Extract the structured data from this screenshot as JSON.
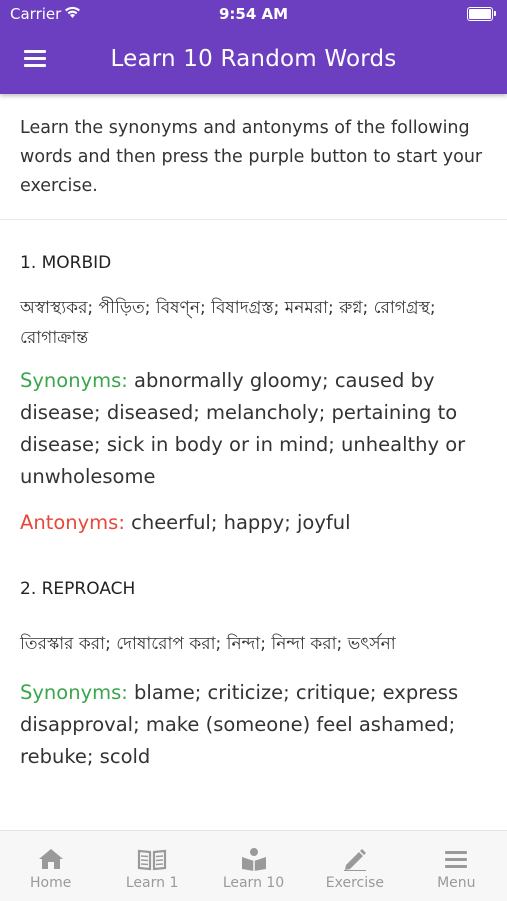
{
  "status_bar": {
    "carrier": "Carrier",
    "time": "9:54 AM"
  },
  "header": {
    "title": "Learn 10 Random Words"
  },
  "intro": "Learn the synonyms and antonyms of the following words and then press the purple button to start your exercise.",
  "labels": {
    "synonyms": "Synonyms:",
    "antonyms": "Antonyms:"
  },
  "words": [
    {
      "title": "1. MORBID",
      "bangla": "অস্বাস্থ্যকর; পীড়িত; বিষণ্ন; বিষাদগ্রস্ত; মনমরা; রুগ্ন; রোগগ্রস্থ; রোগাক্রান্ত",
      "synonyms": "abnormally gloomy; caused by disease; diseased; melancholy; pertaining to disease; sick in body or in mind; unhealthy or unwholesome",
      "antonyms": "cheerful; happy; joyful"
    },
    {
      "title": "2. REPROACH",
      "bangla": "তিরস্কার করা; দোষারোপ করা; নিন্দা; নিন্দা করা; ভৎর্সনা",
      "synonyms": "blame; criticize; critique; express disapproval; make (someone) feel ashamed; rebuke; scold"
    }
  ],
  "tabs": [
    {
      "label": "Home",
      "icon": "home-icon"
    },
    {
      "label": "Learn 1",
      "icon": "book-open-icon"
    },
    {
      "label": "Learn 10",
      "icon": "reader-icon"
    },
    {
      "label": "Exercise",
      "icon": "pencil-icon"
    },
    {
      "label": "Menu",
      "icon": "menu-lines-icon"
    }
  ],
  "colors": {
    "header": "#6c3fc0",
    "synonyms": "#3aa64b",
    "antonyms": "#e8473b",
    "tab_inactive": "#9a9a9a"
  }
}
